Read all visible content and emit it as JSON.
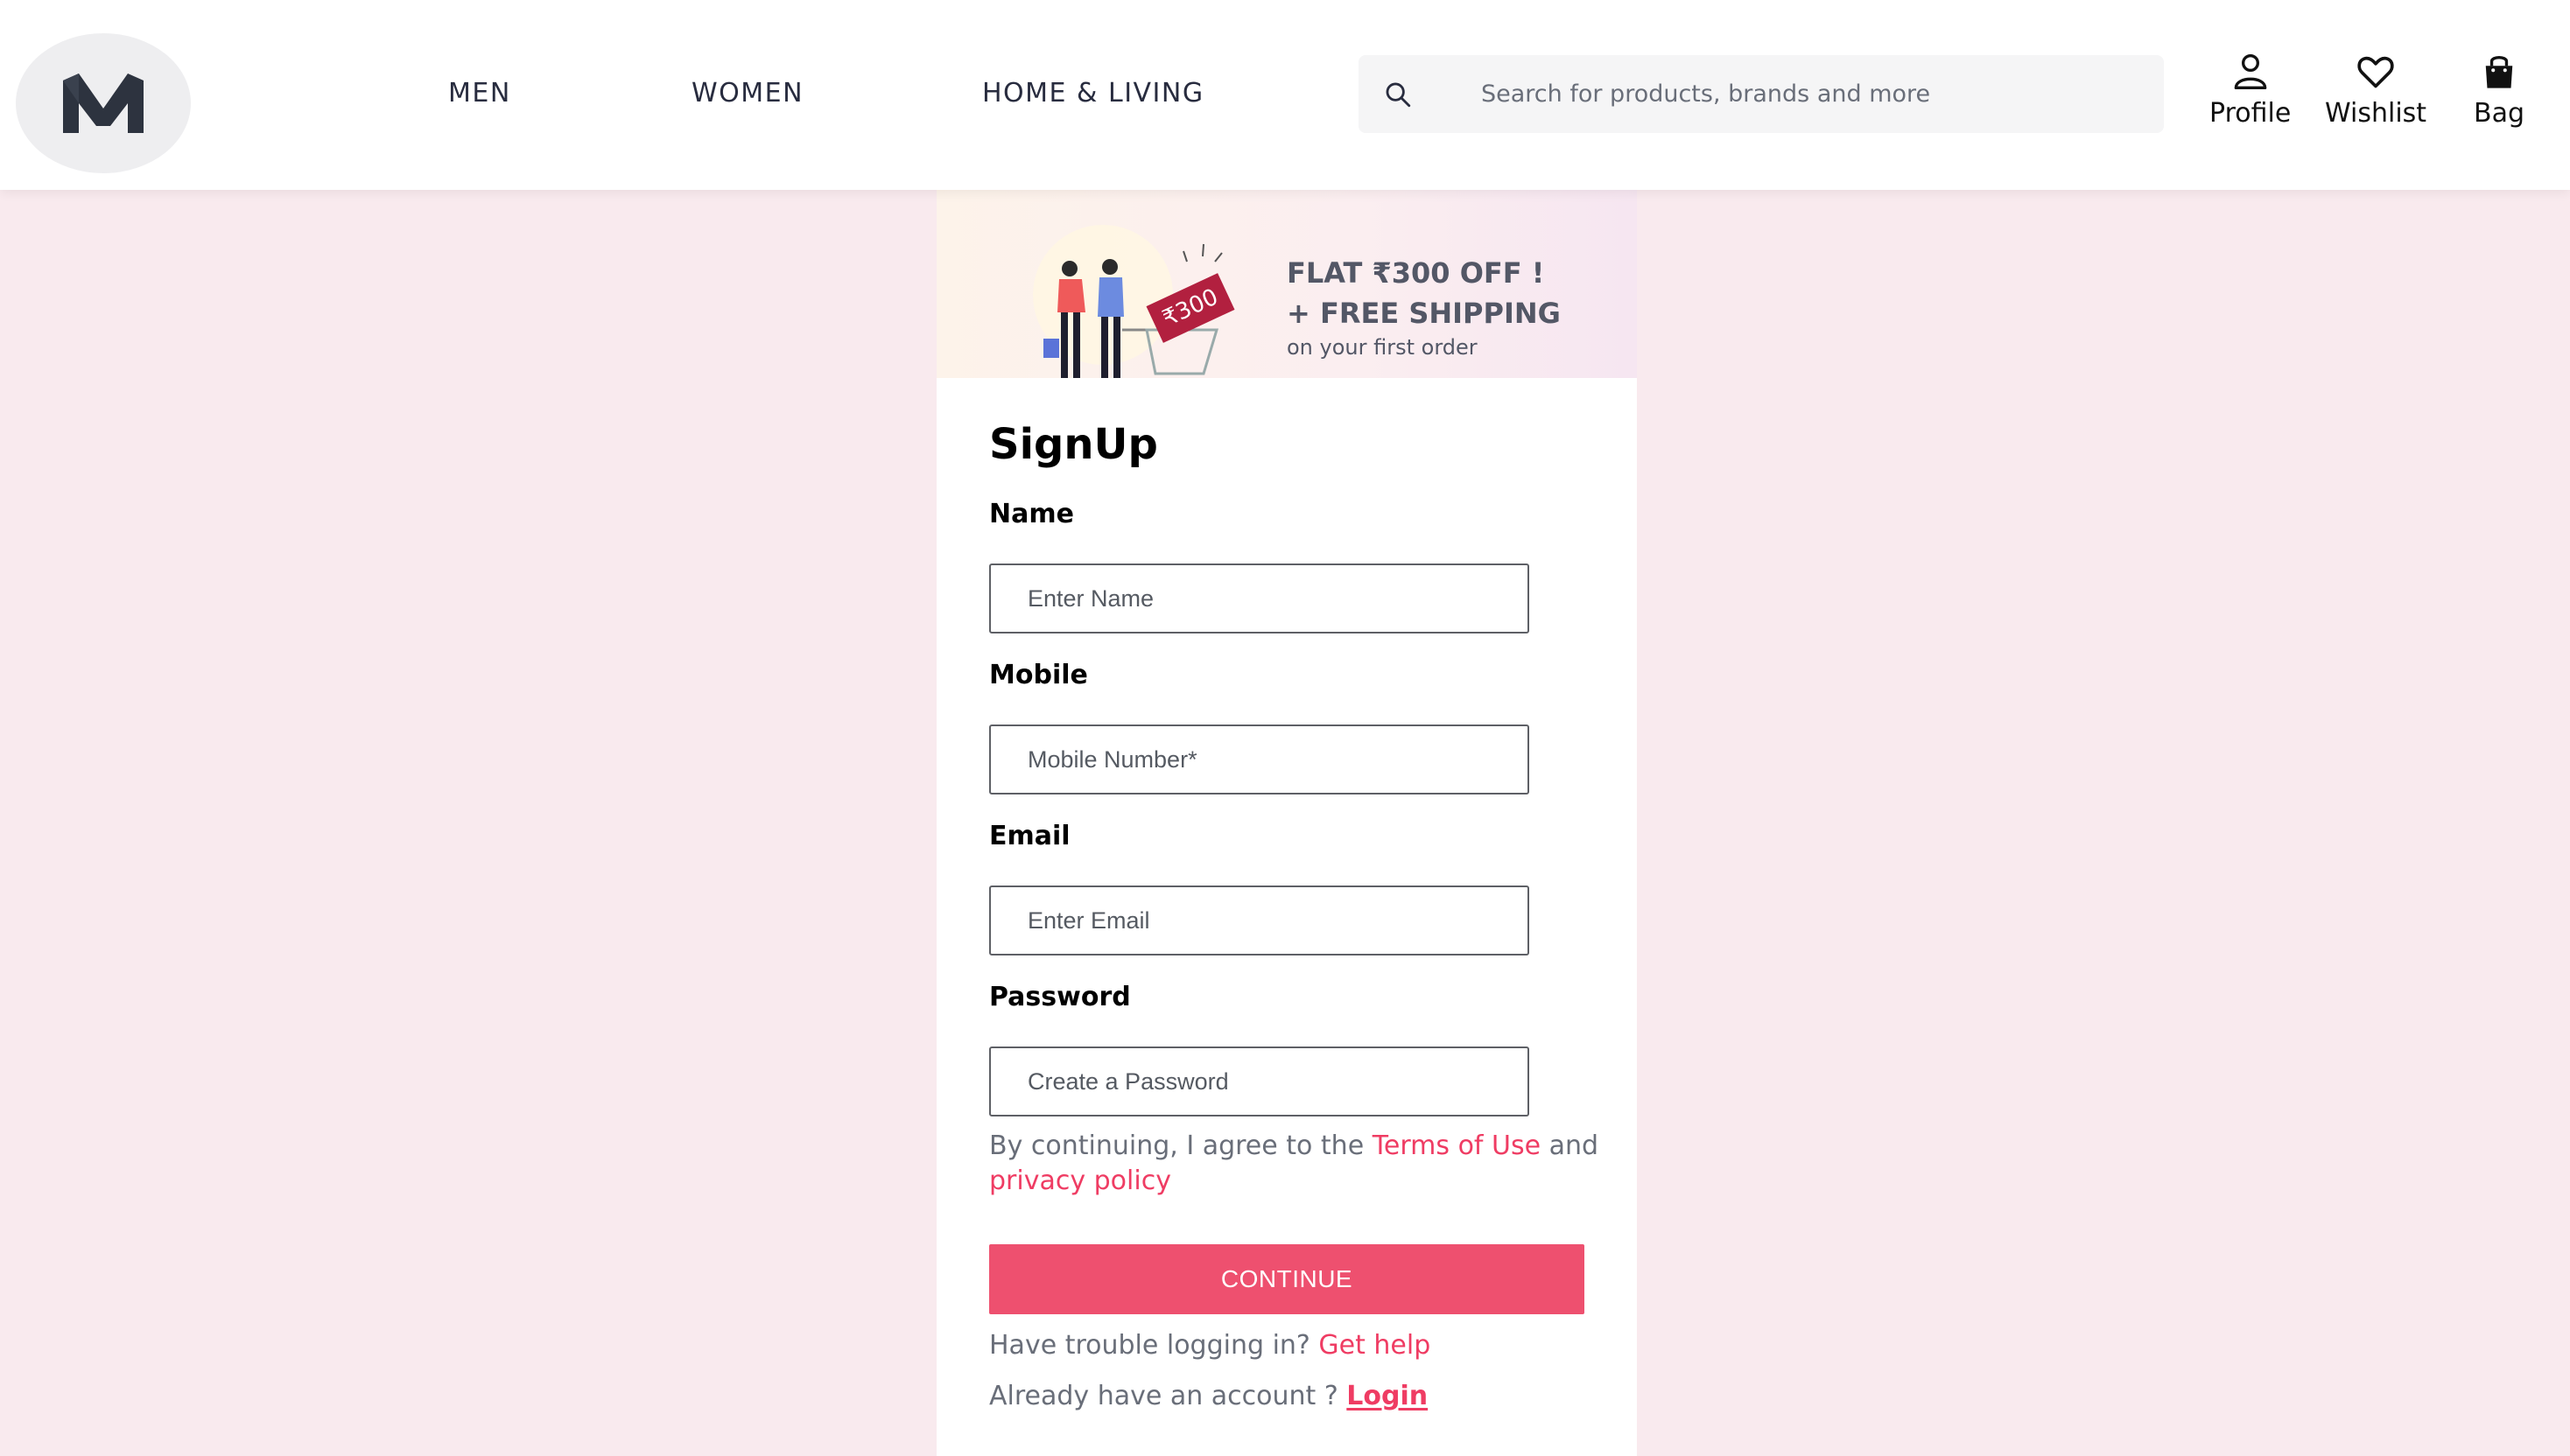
{
  "header": {
    "logo_alt": "M",
    "nav": [
      {
        "label": "MEN"
      },
      {
        "label": "WOMEN"
      },
      {
        "label": "HOME & LIVING"
      }
    ],
    "search": {
      "placeholder": "Search for products, brands and more"
    },
    "actions": {
      "profile": "Profile",
      "wishlist": "Wishlist",
      "bag": "Bag"
    }
  },
  "banner": {
    "line1": "FLAT ₹300 OFF !",
    "line2": "+ FREE SHIPPING",
    "line3": "on your first order",
    "coupon_text": "₹300"
  },
  "form": {
    "title": "SignUp",
    "name": {
      "label": "Name",
      "placeholder": "Enter Name"
    },
    "mobile": {
      "label": "Mobile",
      "placeholder": "Mobile Number*"
    },
    "email": {
      "label": "Email",
      "placeholder": "Enter Email"
    },
    "password": {
      "label": "Password",
      "placeholder": "Create a Password"
    },
    "consent_prefix": "By continuing, I agree to the ",
    "terms_link": "Terms of Use",
    "consent_and": " and",
    "privacy_link": "privacy policy",
    "continue_label": "CONTINUE",
    "trouble_text": "Have trouble logging in? ",
    "help_link": "Get help",
    "account_text": "Already have an account ? ",
    "login_link": "Login"
  },
  "colors": {
    "accent": "#ee506f",
    "link": "#ef3c63",
    "page_bg": "#f9eaee"
  }
}
